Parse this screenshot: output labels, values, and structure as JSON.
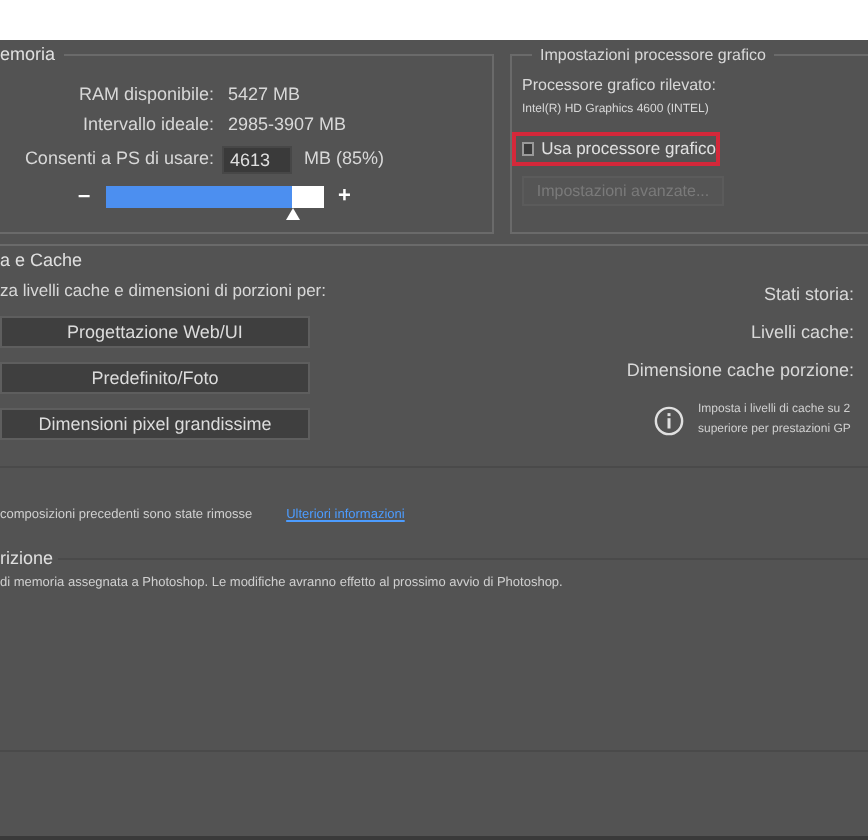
{
  "memory": {
    "title": "emoria",
    "ram_label": "RAM disponibile:",
    "ram_value": "5427 MB",
    "range_label": "Intervallo ideale:",
    "range_value": "2985-3907 MB",
    "allow_label": "Consenti a PS di usare:",
    "allow_value": "4613",
    "allow_unit": "MB (85%)",
    "minus": "–",
    "plus": "+",
    "level": 0.85
  },
  "gpu": {
    "title": "Impostazioni processore grafico",
    "detected_label": "Processore grafico rilevato:",
    "detected_value": "Intel(R) HD Graphics 4600 (INTEL)",
    "use_gpu": {
      "label": "Usa processore grafico",
      "checked": false
    },
    "advanced": {
      "label": "Impostazioni avanzate...",
      "disabled": true
    }
  },
  "cache": {
    "title": "a e Cache",
    "optimize_label": "za livelli cache e dimensioni di porzioni per:",
    "presets": [
      "Progettazione Web/UI",
      "Predefinito/Foto",
      "Dimensioni pixel grandissime"
    ],
    "fields": [
      "Stati storia:",
      "Livelli cache:",
      "Dimensione cache porzione:"
    ],
    "info_lines": [
      "Imposta i livelli di cache su 2",
      "superiore per prestazioni GP"
    ]
  },
  "notice": {
    "text": "composizioni precedenti sono state rimosse",
    "link": "Ulteriori informazioni"
  },
  "description": {
    "title": "rizione",
    "text": "di memoria assegnata a Photoshop. Le modifiche avranno effetto al prossimo avvio di Photoshop."
  }
}
